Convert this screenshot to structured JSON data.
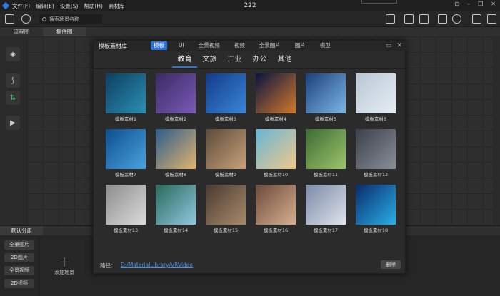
{
  "menu": [
    "文件(F)",
    "编辑(E)",
    "设置(S)",
    "帮助(H)",
    "素材库"
  ],
  "window_title": "222",
  "search": {
    "placeholder": "搜索场景名称"
  },
  "view_tabs": [
    "流程图",
    "集件图"
  ],
  "bottom_panel": {
    "group_tab": "默认分组",
    "categories": [
      "全景图片",
      "2D图片",
      "全景视频",
      "2D视频"
    ],
    "add_scene_label": "添加场景"
  },
  "modal": {
    "title": "模板素材库",
    "types": [
      "模板",
      "UI",
      "全景视频",
      "视频",
      "全景图片",
      "图片",
      "模型"
    ],
    "selected_type": 0,
    "categories": [
      "教育",
      "文旅",
      "工业",
      "办公",
      "其他"
    ],
    "selected_category": 0,
    "items": [
      {
        "label": "模板素材1",
        "colors": [
          "#0e3f5f",
          "#2b8fb5"
        ]
      },
      {
        "label": "模板素材2",
        "colors": [
          "#3b2a63",
          "#7a5bb8"
        ]
      },
      {
        "label": "模板素材3",
        "colors": [
          "#123a88",
          "#3a86d8"
        ]
      },
      {
        "label": "模板素材4",
        "colors": [
          "#0a1440",
          "#d27a2a"
        ]
      },
      {
        "label": "模板素材5",
        "colors": [
          "#1c3f7a",
          "#7db7e8"
        ]
      },
      {
        "label": "模板素材6",
        "colors": [
          "#b9c6d3",
          "#e6eef5"
        ]
      },
      {
        "label": "模板素材7",
        "colors": [
          "#0d4e8c",
          "#4aa3e0"
        ]
      },
      {
        "label": "模板素材8",
        "colors": [
          "#2c5c8a",
          "#e0b56e"
        ]
      },
      {
        "label": "模板素材9",
        "colors": [
          "#5b4a3a",
          "#c9a27a"
        ]
      },
      {
        "label": "模板素材10",
        "colors": [
          "#66b6d6",
          "#f0c98a"
        ]
      },
      {
        "label": "模板素材11",
        "colors": [
          "#3d6b35",
          "#9cc56a"
        ]
      },
      {
        "label": "模板素材12",
        "colors": [
          "#3a3f4a",
          "#8a8f99"
        ]
      },
      {
        "label": "模板素材13",
        "colors": [
          "#8c8c8c",
          "#dcdcdc"
        ]
      },
      {
        "label": "模板素材14",
        "colors": [
          "#2a6a5a",
          "#8fc7e0"
        ]
      },
      {
        "label": "模板素材15",
        "colors": [
          "#4a3a32",
          "#a88a6a"
        ]
      },
      {
        "label": "模板素材16",
        "colors": [
          "#6a4a3a",
          "#d8b090"
        ]
      },
      {
        "label": "模板素材17",
        "colors": [
          "#7a8aa8",
          "#e0e4ec"
        ]
      },
      {
        "label": "模板素材18",
        "colors": [
          "#0a2a6a",
          "#2ab0e8"
        ]
      }
    ],
    "path_label": "路径：",
    "path_value": "D:/MaterialLibrary/VRVideo",
    "delete_label": "删除"
  },
  "colors": {
    "accent": "#2f74d6",
    "link": "#4a90e2"
  }
}
